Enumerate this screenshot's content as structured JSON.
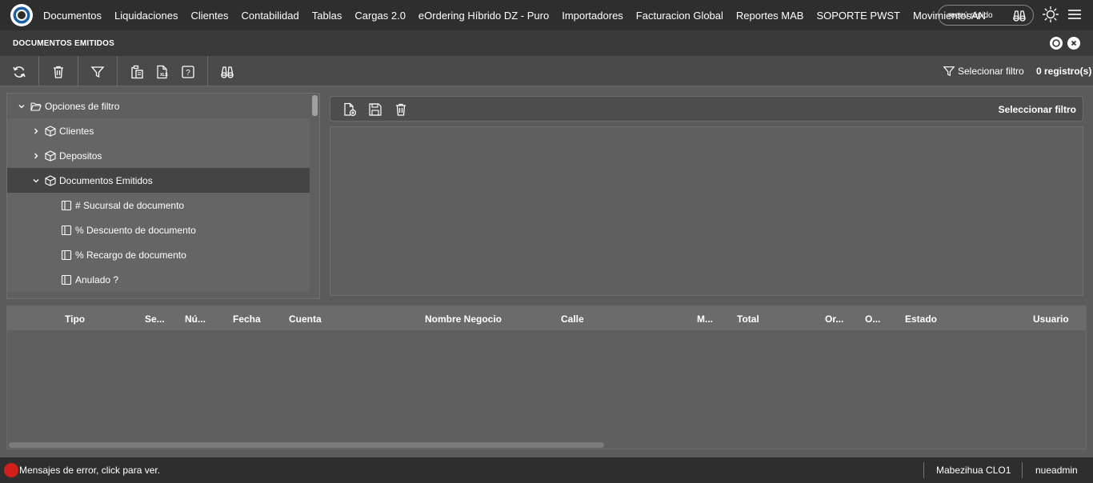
{
  "nav": {
    "items": [
      "Documentos",
      "Liquidaciones",
      "Clientes",
      "Contabilidad",
      "Tablas",
      "Cargas 2.0",
      "eOrdering Híbrido DZ - Puro",
      "Importadores",
      "Facturacion Global",
      "Reportes MAB",
      "SOPORTE PWST",
      "MovimientosAN"
    ],
    "quick_menu_label": "menú rápido"
  },
  "window": {
    "title": "DOCUMENTOS EMITIDOS"
  },
  "toolbar": {
    "select_filter_label": "Selecionar filtro",
    "records_label": "0 registro(s)"
  },
  "tree": {
    "root_label": "Opciones de filtro",
    "rows": [
      {
        "label": "Clientes"
      },
      {
        "label": "Depositos"
      },
      {
        "label": "Documentos Emitidos"
      },
      {
        "label": "# Sucursal de documento"
      },
      {
        "label": "% Descuento de documento"
      },
      {
        "label": "% Recargo de documento"
      },
      {
        "label": "Anulado ?"
      }
    ]
  },
  "filter_panel": {
    "select_filter_label": "Seleccionar filtro"
  },
  "grid": {
    "columns": [
      "Tipo",
      "Se...",
      "Nú...",
      "Fecha",
      "Cuenta",
      "Nombre Negocio",
      "Calle",
      "M...",
      "Total",
      "Or...",
      "O...",
      "Estado",
      "Usuario"
    ]
  },
  "footer": {
    "error_text": "Mensajes de error, click para ver.",
    "branch": "Mabezihua CLO1",
    "user": "nueadmin"
  },
  "colors": {
    "topbar": "#2e2e2e",
    "error_dot": "#d0201c"
  }
}
